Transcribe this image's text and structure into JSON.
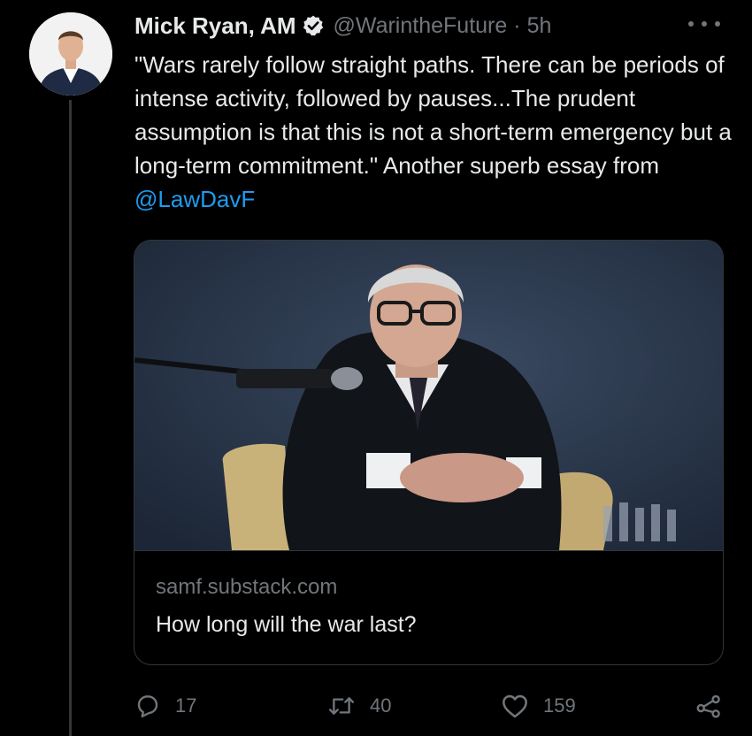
{
  "author": {
    "display_name": "Mick Ryan, AM",
    "handle": "@WarintheFuture",
    "separator": "·",
    "time": "5h",
    "verified": true,
    "avatar_icon": "avatar-photo"
  },
  "tweet": {
    "text_before_mention": "\"Wars rarely follow straight paths. There can be periods of intense activity, followed by pauses...The prudent assumption is that this is not a short-term emergency but a long-term commitment.\" Another superb essay from ",
    "mention": "@LawDavF"
  },
  "card": {
    "domain": "samf.substack.com",
    "title": "How long will the war last?",
    "image_icon": "article-photo"
  },
  "actions": {
    "reply_count": "17",
    "retweet_count": "40",
    "like_count": "159"
  },
  "colors": {
    "background": "#000000",
    "text": "#e7e9ea",
    "muted": "#71767b",
    "accent": "#1d9bf0",
    "border": "#333639"
  }
}
